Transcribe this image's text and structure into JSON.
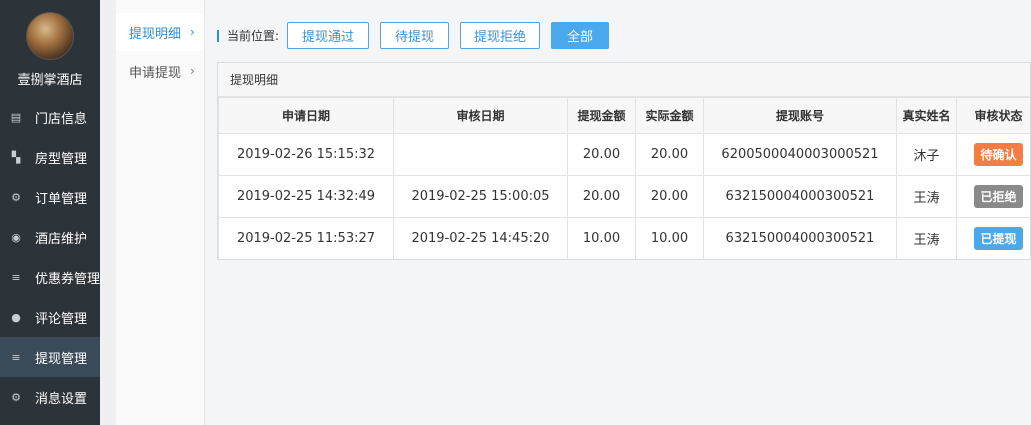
{
  "sidebar": {
    "brand_name": "壹捌掌酒店",
    "items": [
      {
        "label": "门店信息",
        "icon": "▤"
      },
      {
        "label": "房型管理",
        "icon": "▚"
      },
      {
        "label": "订单管理",
        "icon": "⚙"
      },
      {
        "label": "酒店维护",
        "icon": "◉"
      },
      {
        "label": "优惠券管理",
        "icon": "≡"
      },
      {
        "label": "评论管理",
        "icon": "●"
      },
      {
        "label": "提现管理",
        "icon": "≡",
        "active": true
      },
      {
        "label": "消息设置",
        "icon": "⚙"
      }
    ]
  },
  "submenu": {
    "items": [
      {
        "label": "提现明细",
        "active": true
      },
      {
        "label": "申请提现"
      }
    ],
    "chevron": "›"
  },
  "filter": {
    "location_label": "当前位置:",
    "buttons": [
      "提现通过",
      "待提现",
      "提现拒绝",
      "全部"
    ]
  },
  "panel": {
    "title": "提现明细",
    "columns": [
      "申请日期",
      "审核日期",
      "提现金额",
      "实际金额",
      "提现账号",
      "真实姓名",
      "审核状态"
    ],
    "rows": [
      {
        "apply_date": "2019-02-26 15:15:32",
        "review_date": "",
        "amount": "20.00",
        "actual": "20.00",
        "account": "6200500040003000521",
        "name": "沐子",
        "status": "待确认",
        "status_color": "#f57c45"
      },
      {
        "apply_date": "2019-02-25 14:32:49",
        "review_date": "2019-02-25 15:00:05",
        "amount": "20.00",
        "actual": "20.00",
        "account": "632150004000300521",
        "name": "王涛",
        "status": "已拒绝",
        "status_color": "#8a8a8a"
      },
      {
        "apply_date": "2019-02-25 11:53:27",
        "review_date": "2019-02-25 14:45:20",
        "amount": "10.00",
        "actual": "10.00",
        "account": "632150004000300521",
        "name": "王涛",
        "status": "已提现",
        "status_color": "#4aa8ec"
      }
    ]
  }
}
